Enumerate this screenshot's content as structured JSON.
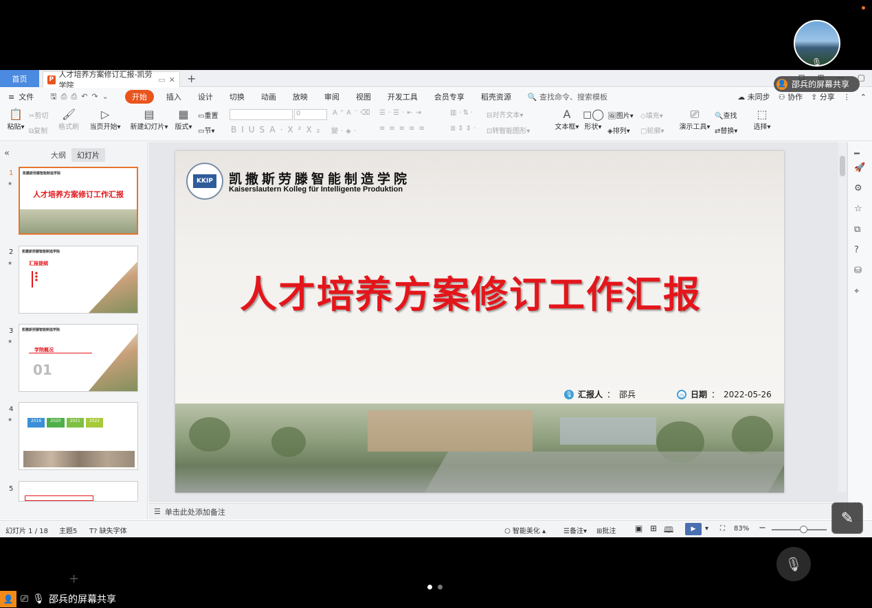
{
  "share": {
    "presenter_label": "邵兵的屏幕共享",
    "bottom_label": "邵兵的屏幕共享"
  },
  "tabs": {
    "home": "首页",
    "document": "人才培养方案修订汇报-凯劳学院"
  },
  "menu": {
    "file": "文件",
    "items": [
      "开始",
      "插入",
      "设计",
      "切换",
      "动画",
      "放映",
      "审阅",
      "视图",
      "开发工具",
      "会员专享",
      "稻壳资源"
    ],
    "search_placeholder": "查找命令、搜索模板",
    "sync": "未同步",
    "collab": "协作",
    "share": "分享"
  },
  "ribbon": {
    "paste": "粘贴",
    "cut": "剪切",
    "copy": "复制",
    "format_painter": "格式刷",
    "from_current": "当页开始",
    "new_slide": "新建幻灯片",
    "layout": "版式",
    "reset": "重置",
    "section": "节",
    "font_size": "0",
    "align_text": "对齐文本",
    "convert_smartart": "转智能图形",
    "textbox": "文本框",
    "shape": "形状",
    "picture": "图片",
    "fill": "填充",
    "arrange": "排列",
    "outline": "轮廓",
    "present_tools": "演示工具",
    "find": "查找",
    "replace": "替换",
    "select": "选择"
  },
  "leftpane": {
    "outline_tab": "大纲",
    "slides_tab": "幻灯片",
    "thumbs": [
      {
        "num": "1",
        "title": "人才培养方案修订工作汇报"
      },
      {
        "num": "2",
        "title": "汇报提纲"
      },
      {
        "num": "3",
        "title": "学院概况"
      },
      {
        "num": "4",
        "title": ""
      },
      {
        "num": "5",
        "title": ""
      }
    ],
    "thumb3_num": "01",
    "thumb4_years": [
      "2016",
      "2020",
      "2021",
      "2022"
    ]
  },
  "slide": {
    "school_cn": "凯撒斯劳滕智能制造学院",
    "school_de": "Kaiserslautern Kolleg für Intelligente Produktion",
    "logo_text": "KKIP",
    "title": "人才培养方案修订工作汇报",
    "reporter_label": "汇报人",
    "reporter_name": "邵兵",
    "date_label": "日期",
    "date_value": "2022-05-26"
  },
  "notes": {
    "placeholder": "单击此处添加备注"
  },
  "status": {
    "slide_counter": "幻灯片 1 / 18",
    "theme": "主题5",
    "missing_font": "缺失字体",
    "smart_beautify": "智能美化",
    "notes": "备注",
    "comments": "批注",
    "zoom": "83%"
  }
}
